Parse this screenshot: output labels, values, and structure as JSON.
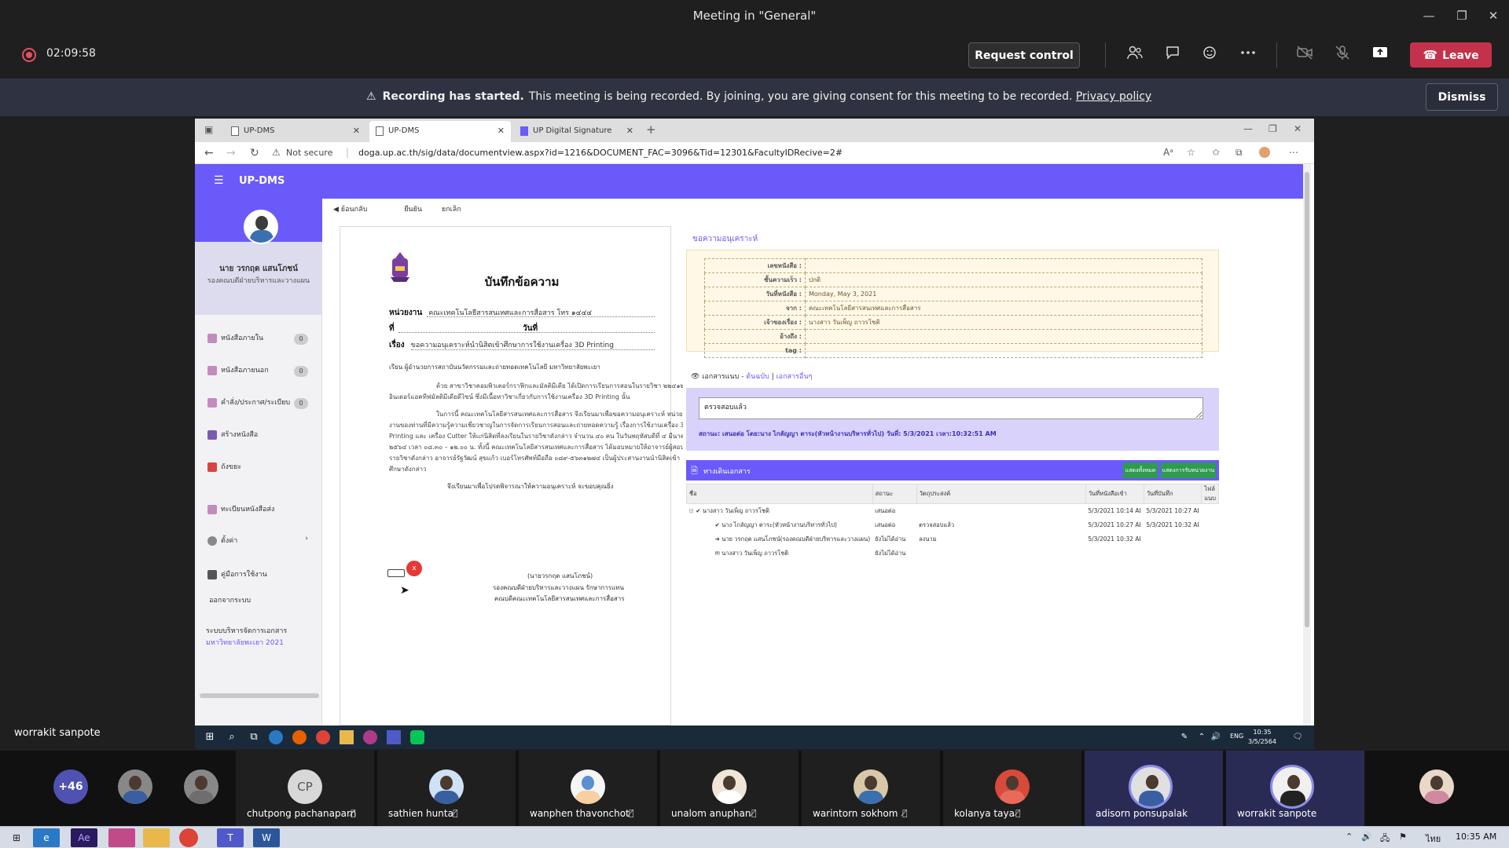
{
  "window": {
    "title": "Meeting in \"General\"",
    "minimize": "—",
    "restore": "❐",
    "close": "✕"
  },
  "toolbar": {
    "timer": "02:09:58",
    "request_control": "Request control",
    "leave": "Leave",
    "accent": "#c4314b"
  },
  "banner": {
    "bold": "Recording has started.",
    "text": "This meeting is being recorded. By joining, you are giving consent for this meeting to be recorded.",
    "link": "Privacy policy",
    "dismiss": "Dismiss"
  },
  "browser": {
    "tabs": [
      "UP-DMS",
      "UP-DMS",
      "UP Digital Signature"
    ],
    "new_tab": "+",
    "not_secure": "Not secure",
    "url": "doga.up.ac.th/sig/data/documentview.aspx?id=1216&DOCUMENT_FAC=3096&Tid=12301&FacultyIDRecive=2#"
  },
  "app": {
    "title": "UP-DMS",
    "accent": "#6a5af9",
    "profile_name": "นาย วรกฤต แสนโภชน์",
    "profile_role": "รองคณบดีฝ่ายบริหารและวางแผน",
    "menu": [
      {
        "label": "หนังสือภายใน",
        "badge": "0"
      },
      {
        "label": "หนังสือภายนอก",
        "badge": "0"
      },
      {
        "label": "คำสั่ง/ประกาศ/ระเบียบ",
        "badge": "0"
      },
      {
        "label": "สร้างหนังสือ"
      },
      {
        "label": "ถังขยะ"
      },
      {
        "label": "ทะเบียนหนังสือส่ง"
      },
      {
        "label": "ตั้งค่า"
      },
      {
        "label": "คู่มือการใช้งาน"
      },
      {
        "label": "ออกจากระบบ"
      }
    ],
    "footer_1": "ระบบบริหารจัดการเอกสาร",
    "footer_2": "มหาวิทยาลัยพะเยา 2021",
    "content_toolbar": [
      "ย้อนกลับ",
      "ยืนยัน",
      "ยกเลิก"
    ]
  },
  "document": {
    "title": "บันทึกข้อความ",
    "agency_label": "หน่วยงาน",
    "agency_value": "คณะเทคโนโลยีสารสนเทศและการสื่อสาร   โทร ๑๔๔๔",
    "no_label": "ที่",
    "date_label": "วันที่",
    "subject_label": "เรื่อง",
    "subject_value": "ขอความอนุเคราะห์นำนิสิตเข้าศึกษาการใช้งานเครื่อง 3D Printing",
    "to_line": "เรียน   ผู้อำนวยการสถาบันนวัตกรรมและถ่ายทอดเทคโนโลยี มหาวิทยาลัยพะเยา",
    "para_1": "ด้วย สาขาวิชาคอมพิวเตอร์กราฟิกและมัลติมีเดีย ได้เปิดการเรียนการสอนในรายวิชา ๒๒๔๑๒๑ อินเตอร์แอคทีฟมัลติมีเดียดีไซน์ ซึ่งมีเนื้อหาวิชาเกี่ยวกับการใช้งานเครื่อง 3D Printing นั้น",
    "para_2": "ในการนี้ คณะเทคโนโลยีสารสนเทศและการสื่อสาร จึงเรียนมาเพื่อขอความอนุเคราะห์ หน่วยงานของท่านที่มีความรู้ความเชี่ยวชาญในการจัดการเรียนการสอนและถ่ายทอดความรู้ เรื่องการใช้งานเครื่อง 3D Printing และ เครื่อง Cutter ให้แก่นิสิตที่ลงเรียนในรายวิชาดังกล่าว จำนวน ๔๐ คน ในวันพฤหัสบดีที่ ๔ มีนาคม ๒๕๖๔ เวลา ๐๘.๓๐ – ๑๒.๐๐ น. ทั้งนี้ คณะเทคโนโลยีสารสนเทศและการสื่อสาร ได้มอบหมายให้อาจารย์ผู้สอนในรายวิชาดังกล่าว อาจารย์รัฐวัฒน์ สุขแก้ว เบอร์โทรศัพท์มือถือ ๐๘๙-๕๖๓๑๒๗๔ เป็นผู้ประสานงานนำนิสิตเข้าศึกษาดังกล่าว",
    "para_3": "จึงเรียนมาเพื่อโปรดพิจารณาให้ความอนุเคราะห์ จะขอบคุณยิ่ง",
    "sig_name": "(นายวรกฤต  แสนโภชน์)",
    "sig_role_1": "รองคณบดีฝ่ายบริหารและวางแผน รักษาการแทน",
    "sig_role_2": "คณบดีคณะเทคโนโลยีสารสนเทศและการสื่อสาร",
    "sig_badge": "x"
  },
  "panel": {
    "title": "ขอความอนุเคราะห์",
    "info": [
      {
        "k": "เลขหนังสือ :",
        "v": ""
      },
      {
        "k": "ชั้นความเร็ว :",
        "v": "ปกติ"
      },
      {
        "k": "วันที่หนังสือ :",
        "v": "Monday, May 3, 2021"
      },
      {
        "k": "จาก :",
        "v": "คณะเทคโนโลยีสารสนเทศและการสื่อสาร"
      },
      {
        "k": "เจ้าของเรื่อง :",
        "v": "นางสาว วันเพ็ญ ถาวรโชติ"
      },
      {
        "k": "อ้างถึง :",
        "v": ""
      },
      {
        "k": "tag :",
        "v": ""
      }
    ],
    "attach_label": "เอกสารแนบ -",
    "attach_link_1": "ต้นฉบับ",
    "attach_link_2": "เอกสารอื่นๆ",
    "note_value": "ตรวจสอบแล้ว",
    "note_status": "สถานะ: เสนอต่อ  โดย:นาง ไกลัญญา ตาระ(หัวหน้างานบริหารทั่วไป)   วันที่: 5/3/2021  เวลา:10:32:51 AM",
    "route_title": "ทางเดินเอกสาร",
    "route_btn_1": "แสดงทั้งหมด",
    "route_btn_2": "แสดงการรับหน่วยงาน",
    "route_headers": [
      "ชื่อ",
      "สถานะ",
      "วัตถุประสงค์",
      "วันที่หนังสือเข้า",
      "วันที่บันทึก",
      "ไฟล์แนบ"
    ],
    "route_rows": [
      {
        "name": "นางสาว วันเพ็ญ ถาวรโชติ",
        "status": "เสนอต่อ",
        "purpose": "",
        "in": "5/3/2021 10:14 AI",
        "saved": "5/3/2021 10:27 AI"
      },
      {
        "name": "นาง ไกลัญญา ตาระ(หัวหน้างานบริหารทั่วไป)",
        "status": "เสนอต่อ",
        "purpose": "ตรวจสอบแล้ว",
        "in": "5/3/2021 10:27 AI",
        "saved": "5/3/2021 10:32 AI"
      },
      {
        "name": "นาย วรกฤต แสนโภชน์(รองคณบดีฝ่ายบริหารและวางแผน)",
        "status": "ยังไม่ได้อ่าน",
        "purpose": "ลงนาม",
        "in": "5/3/2021 10:32 AI",
        "saved": ""
      },
      {
        "name": "นางสาว วันเพ็ญ ถาวรโชติ",
        "status": "ยังไม่ได้อ่าน",
        "purpose": "",
        "in": "",
        "saved": ""
      }
    ]
  },
  "remote_taskbar": {
    "lang": "ENG",
    "time": "10:35",
    "date": "3/5/2564"
  },
  "presenter": "worrakit sanpote",
  "participants": {
    "more": "+46",
    "cp_initials": "CP",
    "names": [
      "chutpong pachanaparn",
      "sathien hunta",
      "wanphen thavonchot",
      "unalom anuphan",
      "warintorn sokhom",
      "kolanya taya",
      "adisorn ponsupalak",
      "worrakit sanpote"
    ]
  },
  "local_taskbar": {
    "lang": "ไทย",
    "time": "10:35 AM"
  }
}
